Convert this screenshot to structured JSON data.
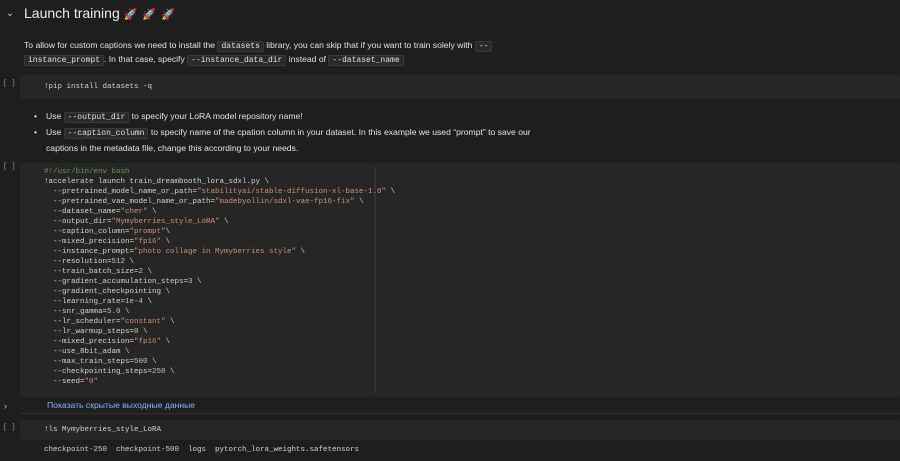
{
  "section": {
    "title": "Launch training",
    "emoji": "🚀 🚀 🚀"
  },
  "intro": {
    "p1_a": "To allow for custom captions we need to install the ",
    "p1_code1": "datasets",
    "p1_b": " library, you can skip that if you want to train solely with ",
    "p1_code2": "--",
    "p2_code1": "instance_prompt",
    "p2_a": ". In that case, specify ",
    "p2_code2": "--instance_data_dir",
    "p2_b": " instead of ",
    "p2_code3": "--dataset_name"
  },
  "cells": {
    "run_indicator": "[ ]",
    "pip_cell": "!pip install datasets -q",
    "ls_cell": "!ls Mymyberries_style_LoRA",
    "ls_output": "checkpoint-250  checkpoint-500  logs  pytorch_lora_weights.safetensors"
  },
  "bullets": {
    "b1_a": "Use ",
    "b1_code": "--output_dir",
    "b1_b": " to specify your LoRA model repository name!",
    "b2_a": "Use ",
    "b2_code": "--caption_column",
    "b2_b": " to specify name of the cpation column in your dataset. In this example we used “prompt” to save our",
    "b2_c": "captions in the metadata file, change this according to your needs."
  },
  "train_cell": {
    "lines": [
      "#!/usr/bin/env bash",
      "!accelerate launch train_dreambooth_lora_sdxl.py \\",
      "  --pretrained_model_name_or_path=\"stabilityai/stable-diffusion-xl-base-1.0\" \\",
      "  --pretrained_vae_model_name_or_path=\"madebyollin/sdxl-vae-fp16-fix\" \\",
      "  --dataset_name=\"cher\" \\",
      "  --output_dir=\"Mymyberries_style_LoRA\" \\",
      "  --caption_column=\"prompt\"\\",
      "  --mixed_precision=\"fp16\" \\",
      "  --instance_prompt=\"photo collage in Mymyberries style\" \\",
      "  --resolution=512 \\",
      "  --train_batch_size=2 \\",
      "  --gradient_accumulation_steps=3 \\",
      "  --gradient_checkpointing \\",
      "  --learning_rate=1e-4 \\",
      "  --snr_gamma=5.0 \\",
      "  --lr_scheduler=\"constant\" \\",
      "  --lr_warmup_steps=0 \\",
      "  --mixed_precision=\"fp16\" \\",
      "  --use_8bit_adam \\",
      "  --max_train_steps=500 \\",
      "  --checkpointing_steps=250 \\",
      "  --seed=\"0\""
    ]
  },
  "output": {
    "toggle_icon": "chevron-right-icon",
    "show_hidden": "Показать скрытые выходные данные"
  }
}
